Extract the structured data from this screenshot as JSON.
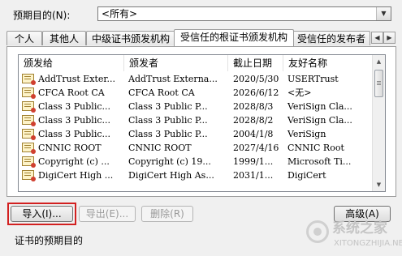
{
  "purpose": {
    "label": "预期目的(N):",
    "selected": "<所有>"
  },
  "tabs": [
    {
      "label": "个人"
    },
    {
      "label": "其他人"
    },
    {
      "label": "中级证书颁发机构"
    },
    {
      "label": "受信任的根证书颁发机构"
    },
    {
      "label": "受信任的发布者"
    }
  ],
  "active_tab": "受信任的根证书颁发机构",
  "table": {
    "columns": [
      "颁发给",
      "颁发者",
      "截止日期",
      "友好名称"
    ],
    "rows": [
      {
        "issued_to": "AddTrust Exter...",
        "issued_by": "AddTrust Externa...",
        "expires": "2020/5/30",
        "friendly_name": "USERTrust"
      },
      {
        "issued_to": "CFCA Root CA",
        "issued_by": "CFCA Root CA",
        "expires": "2026/6/12",
        "friendly_name": "<无>"
      },
      {
        "issued_to": "Class 3 Public...",
        "issued_by": "Class 3 Public P...",
        "expires": "2028/8/3",
        "friendly_name": "VeriSign Cla..."
      },
      {
        "issued_to": "Class 3 Public...",
        "issued_by": "Class 3 Public P...",
        "expires": "2028/8/2",
        "friendly_name": "VeriSign Cla..."
      },
      {
        "issued_to": "Class 3 Public...",
        "issued_by": "Class 3 Public P...",
        "expires": "2004/1/8",
        "friendly_name": "VeriSign"
      },
      {
        "issued_to": "CNNIC ROOT",
        "issued_by": "CNNIC ROOT",
        "expires": "2027/4/16",
        "friendly_name": "CNNIC Root"
      },
      {
        "issued_to": "Copyright (c) ...",
        "issued_by": "Copyright (c) 19...",
        "expires": "1999/1...",
        "friendly_name": "Microsoft Ti..."
      },
      {
        "issued_to": "DigiCert High ...",
        "issued_by": "DigiCert High As...",
        "expires": "2031/1...",
        "friendly_name": "DigiCert"
      }
    ]
  },
  "buttons": {
    "import": "导入(I)...",
    "export": "导出(E)...",
    "delete": "删除(R)",
    "advanced": "高级(A)"
  },
  "bottom_label": "证书的预期目的",
  "watermark": {
    "text": "系统之家",
    "url": "XITONGZHIJIA.NET"
  },
  "colors": {
    "highlight": "#d22020"
  }
}
